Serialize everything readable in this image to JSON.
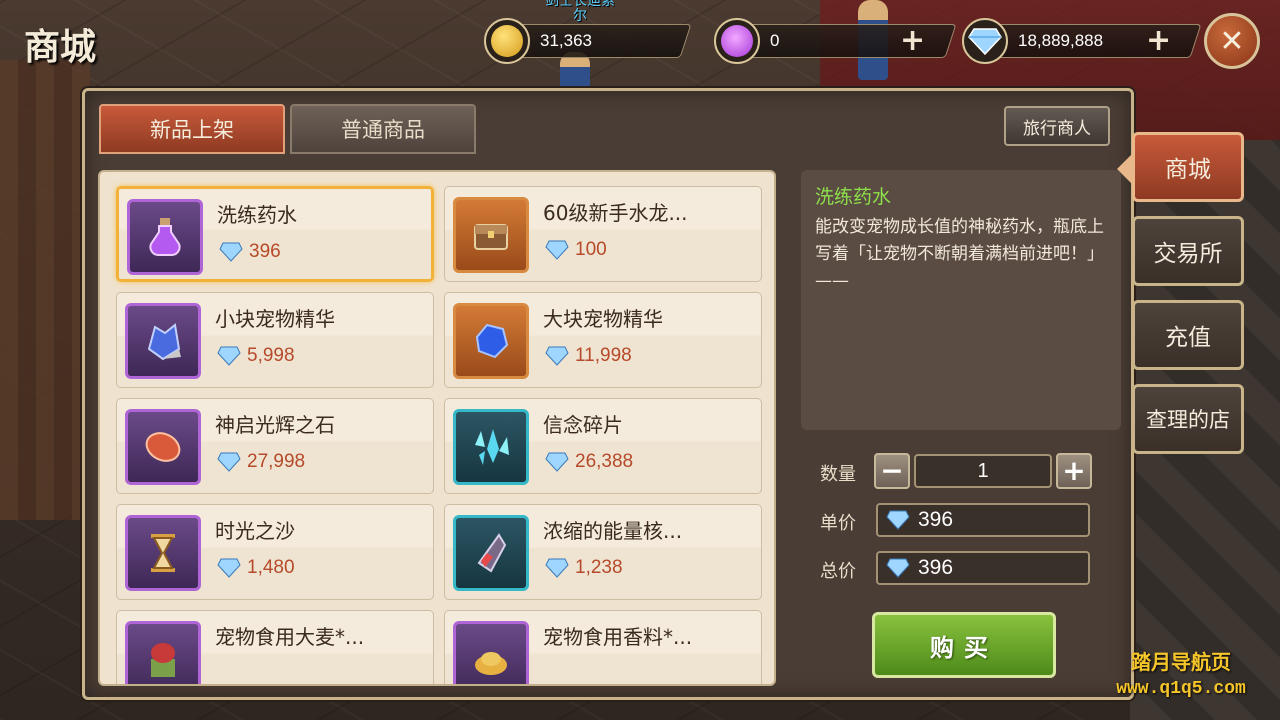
{
  "page": {
    "title": "商城",
    "npc_label": "剑士长迪索尔"
  },
  "currency": {
    "gold": {
      "value": "31,363",
      "icon": "gold-coin-icon"
    },
    "crystal": {
      "value": "0",
      "icon": "purple-crystal-icon",
      "plus": "+"
    },
    "diamond": {
      "value": "18,889,888",
      "icon": "diamond-icon",
      "plus": "+"
    }
  },
  "close": {
    "label": "✕"
  },
  "tabs": [
    {
      "label": "新品上架",
      "active": true
    },
    {
      "label": "普通商品",
      "active": false
    }
  ],
  "merchant_button": "旅行商人",
  "items": [
    {
      "name": "洗练药水",
      "price": "396",
      "icon": "potion-icon",
      "frame": "purple",
      "selected": true
    },
    {
      "name": "60级新手水龙...",
      "price": "100",
      "icon": "chest-icon",
      "frame": "orange"
    },
    {
      "name": "小块宠物精华",
      "price": "5,998",
      "icon": "crystal-cluster-icon",
      "frame": "purple"
    },
    {
      "name": "大块宠物精华",
      "price": "11,998",
      "icon": "sapphire-icon",
      "frame": "orange"
    },
    {
      "name": "神启光辉之石",
      "price": "27,998",
      "icon": "red-stone-icon",
      "frame": "purple"
    },
    {
      "name": "信念碎片",
      "price": "26,388",
      "icon": "shard-icon",
      "frame": "teal"
    },
    {
      "name": "时光之沙",
      "price": "1,480",
      "icon": "hourglass-icon",
      "frame": "purple"
    },
    {
      "name": "浓缩的能量核...",
      "price": "1,238",
      "icon": "energy-core-icon",
      "frame": "teal"
    },
    {
      "name": "宠物食用大麦*...",
      "price": "",
      "icon": "barley-icon",
      "frame": "purple"
    },
    {
      "name": "宠物食用香料*...",
      "price": "",
      "icon": "spice-icon",
      "frame": "purple"
    }
  ],
  "detail": {
    "title": "洗练药水",
    "desc": "能改变宠物成长值的神秘药水，瓶底上写着「让宠物不断朝着满档前进吧！」——"
  },
  "purchase": {
    "qty_label": "数量",
    "qty_value": "1",
    "minus": "−",
    "plus": "+",
    "unit_label": "单价",
    "unit_value": "396",
    "total_label": "总价",
    "total_value": "396",
    "buy_label": "购买"
  },
  "side_tabs": [
    {
      "label": "商城",
      "active": true
    },
    {
      "label": "交易所",
      "active": false
    },
    {
      "label": "充值",
      "active": false
    },
    {
      "label": "查理的店",
      "active": false
    }
  ],
  "watermark": {
    "line1": "踏月导航页",
    "line2": "www.q1q5.com"
  },
  "colors": {
    "price": "#b64a2a",
    "detail_title": "#8de04a",
    "buy": "#6aa82a",
    "tab_active": "#c85a3a"
  }
}
